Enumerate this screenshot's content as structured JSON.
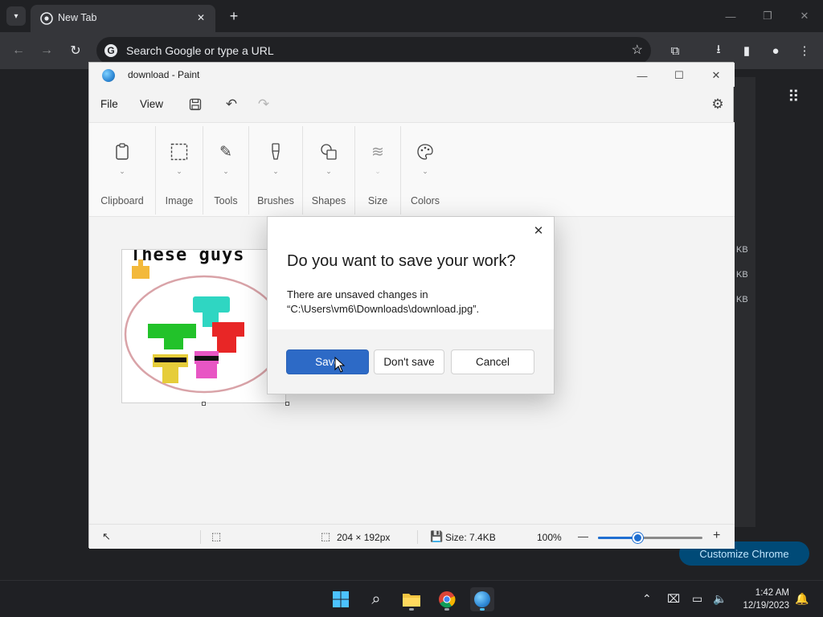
{
  "browser": {
    "tab_title": "New Tab",
    "omnibox_placeholder": "Search Google or type a URL",
    "customize_label": "Customize Chrome",
    "side_sizes": [
      "KB",
      "KB",
      "KB"
    ]
  },
  "paint": {
    "window_title": "download - Paint",
    "menu": {
      "file": "File",
      "view": "View"
    },
    "ribbon_groups": [
      {
        "label": "Clipboard",
        "icon": "clipboard-icon"
      },
      {
        "label": "Image",
        "icon": "image-select-icon"
      },
      {
        "label": "Tools",
        "icon": "tools-icon"
      },
      {
        "label": "Brushes",
        "icon": "brush-icon"
      },
      {
        "label": "Shapes",
        "icon": "shapes-icon"
      },
      {
        "label": "Size",
        "icon": "size-icon"
      },
      {
        "label": "Colors",
        "icon": "palette-icon"
      }
    ],
    "canvas_caption": "These guys",
    "status": {
      "dimensions": "204 × 192px",
      "size": "Size: 7.4KB",
      "zoom": "100%",
      "zoom_fraction": 0.38
    }
  },
  "dialog": {
    "heading": "Do you want to save your work?",
    "message": "There are unsaved changes in “C:\\Users\\vm6\\Downloads\\download.jpg”.",
    "save": "Save",
    "dont_save": "Don't save",
    "cancel": "Cancel"
  },
  "taskbar": {
    "time": "1:42 AM",
    "date": "12/19/2023"
  },
  "colors": {
    "accent": "#2d6ac6",
    "chrome_dark": "#202124",
    "customize_bg": "#004a77"
  }
}
